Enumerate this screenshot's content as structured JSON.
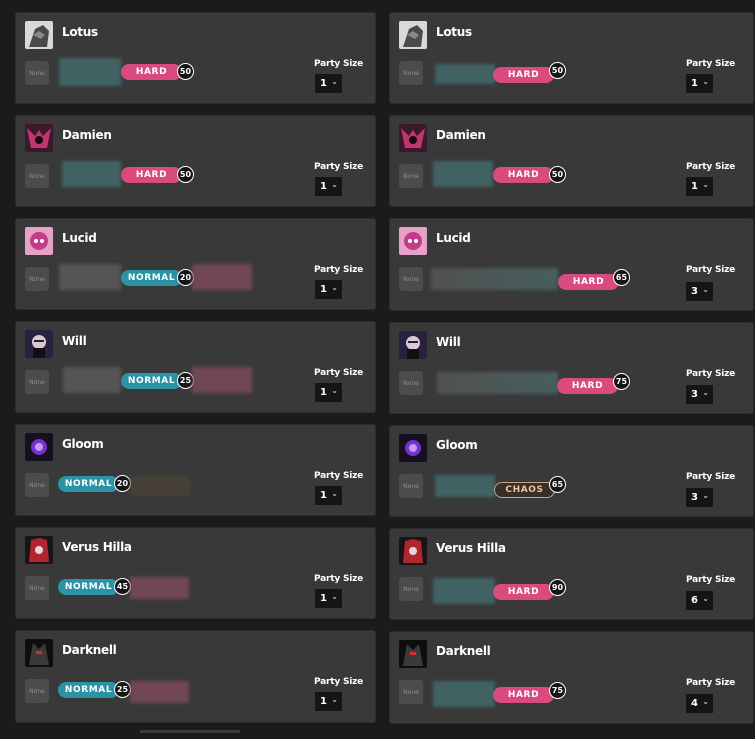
{
  "none_label": "None",
  "party_size_label": "Party Size",
  "left": [
    {
      "name": "Lotus",
      "difficulty": "HARD",
      "count": "50",
      "party": "1",
      "icon": "lotus-icon"
    },
    {
      "name": "Damien",
      "difficulty": "HARD",
      "count": "50",
      "party": "1",
      "icon": "damien-icon"
    },
    {
      "name": "Lucid",
      "difficulty": "NORMAL",
      "count": "20",
      "party": "1",
      "icon": "lucid-icon"
    },
    {
      "name": "Will",
      "difficulty": "NORMAL",
      "count": "25",
      "party": "1",
      "icon": "will-icon"
    },
    {
      "name": "Gloom",
      "difficulty": "NORMAL",
      "count": "20",
      "party": "1",
      "icon": "gloom-icon"
    },
    {
      "name": "Verus Hilla",
      "difficulty": "NORMAL",
      "count": "45",
      "party": "1",
      "icon": "verus-hilla-icon"
    },
    {
      "name": "Darknell",
      "difficulty": "NORMAL",
      "count": "25",
      "party": "1",
      "icon": "darknell-icon"
    }
  ],
  "right": [
    {
      "name": "Lotus",
      "difficulty": "HARD",
      "count": "50",
      "party": "1",
      "icon": "lotus-icon"
    },
    {
      "name": "Damien",
      "difficulty": "HARD",
      "count": "50",
      "party": "1",
      "icon": "damien-icon"
    },
    {
      "name": "Lucid",
      "difficulty": "HARD",
      "count": "65",
      "party": "3",
      "icon": "lucid-icon"
    },
    {
      "name": "Will",
      "difficulty": "HARD",
      "count": "75",
      "party": "3",
      "icon": "will-icon"
    },
    {
      "name": "Gloom",
      "difficulty": "CHAOS",
      "count": "65",
      "party": "3",
      "icon": "gloom-icon"
    },
    {
      "name": "Verus Hilla",
      "difficulty": "HARD",
      "count": "90",
      "party": "6",
      "icon": "verus-hilla-icon"
    },
    {
      "name": "Darknell",
      "difficulty": "HARD",
      "count": "75",
      "party": "4",
      "icon": "darknell-icon"
    }
  ]
}
